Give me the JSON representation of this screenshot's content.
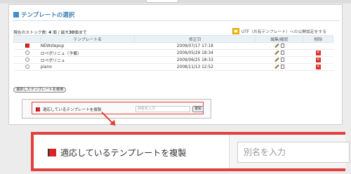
{
  "section": {
    "title": "テンプレートの選択"
  },
  "stock": {
    "prefix": "現在のストック数: ",
    "count": "4",
    "middle": " 個 / 最大",
    "max": "30",
    "suffix": "個まで"
  },
  "utf": {
    "label": "UTF（共有テンプレート）への公開設定をする"
  },
  "table": {
    "headers": [
      "",
      "テンプレート名",
      "修正日",
      "編集/確認",
      "削除"
    ],
    "rows": [
      {
        "name": "NEWstepup",
        "date": "2009/07/17 17:18",
        "selected": true,
        "deletable": false
      },
      {
        "name": "ロペポリニュ（予備）",
        "date": "2009/05/29 18:34",
        "selected": false,
        "deletable": true
      },
      {
        "name": "ロペポリニュ",
        "date": "2009/06/25 18:33",
        "selected": false,
        "deletable": true
      },
      {
        "name": "piano",
        "date": "2008/11/13 12:52",
        "selected": false,
        "deletable": true
      }
    ]
  },
  "actions": {
    "use_template": "選択したテンプレートを使用",
    "copy_label": "適応しているテンプレートを複製",
    "copy_placeholder": "別名を入力",
    "copy_button": "複製"
  },
  "zoom": {
    "copy_label": "適応しているテンプレートを複製",
    "copy_placeholder": "別名を入力"
  },
  "colors": {
    "accent_blue": "#3d7fb3",
    "highlight_red": "#e0413a",
    "name_green": "#2e8b2e"
  }
}
